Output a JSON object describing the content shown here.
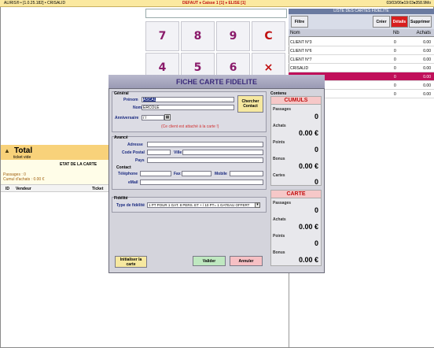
{
  "titlebar": {
    "left": "ALIRIS® • [1.0.25.182] • CRISALID",
    "center": "DEFAUT ♦ Caisse 1 [1] ♦ ELISE [1]",
    "right": "03/03/06♦19:03♦358.9Mo"
  },
  "keypad": {
    "k7": "7",
    "k8": "8",
    "k9": "9",
    "kc": "C",
    "k4": "4",
    "k5": "5",
    "k6": "6",
    "kx": "×"
  },
  "list": {
    "title": "LISTE DES CARTES FIDELITE",
    "buttons": {
      "filtre": "Filtre",
      "creer": "Créer",
      "details": "Détails",
      "supprimer": "Supprimer"
    },
    "columns": {
      "nom": "Nom",
      "nb": "Nb",
      "achats": "Achats"
    },
    "rows": [
      {
        "nom": "CLIENT N°3",
        "nb": "0",
        "achats": "0.00"
      },
      {
        "nom": "CLIENT N°6",
        "nb": "0",
        "achats": "0.00"
      },
      {
        "nom": "CLIENT N°7",
        "nb": "0",
        "achats": "0.00"
      },
      {
        "nom": "CRISALID",
        "nb": "0",
        "achats": "0.00"
      },
      {
        "nom": "",
        "nb": "0",
        "achats": "0.00"
      },
      {
        "nom": "",
        "nb": "0",
        "achats": "0.00"
      },
      {
        "nom": "",
        "nb": "0",
        "achats": "0.00"
      }
    ]
  },
  "left": {
    "total": "Total",
    "ticket_status": "ticket vide",
    "etat": "ETAT DE LA CARTE",
    "passages": "Passages : 0",
    "cumul": "Cumul d'achats : 0.00 €",
    "col_id": "ID",
    "col_vendeur": "Vendeur",
    "col_ticket": "Ticket"
  },
  "dialog": {
    "title": "FICHE CARTE FIDELITE",
    "general": {
      "section": "Général",
      "prenom_label": "Prénom",
      "prenom_value": "ASCAL",
      "nom_label": "Nom",
      "nom_value": "ERCOLE",
      "anniv_label": "Anniversaire",
      "anniv_value": "/ /",
      "chercher": "Chercher Contact",
      "notice": "(Ce client est attaché à la carte !)"
    },
    "avance": {
      "section": "Avancé",
      "adresse": "Adresse",
      "code_postal": "Code Postal",
      "ville": "Ville",
      "pays": "Pays",
      "contact": "Contact",
      "telephone": "Téléphone",
      "fax": "Fax",
      "mobile": "Mobile",
      "email": "eMail"
    },
    "fidelite": {
      "section": "Fidélité",
      "type_label": "Type de fidélité",
      "type_value": "1 PT POUR 1 GAT. 8 PERS. ET + / 10 PT= 1 GATEAU OFFERT"
    },
    "buttons": {
      "init": "Initialiser la carte",
      "valider": "Valider",
      "annuler": "Annuler"
    },
    "contenu": {
      "section": "Contenu",
      "cumuls_title": "CUMULS",
      "carte_title": "CARTE",
      "cumuls": [
        {
          "label": "Passages",
          "value": "0"
        },
        {
          "label": "Achats",
          "value": "0.00 €"
        },
        {
          "label": "Points",
          "value": "0"
        },
        {
          "label": "Bonus",
          "value": "0.00 €"
        },
        {
          "label": "Cartes",
          "value": "0"
        }
      ],
      "carte": [
        {
          "label": "Passages",
          "value": "0"
        },
        {
          "label": "Achats",
          "value": "0.00 €"
        },
        {
          "label": "Points",
          "value": "0"
        },
        {
          "label": "Bonus",
          "value": "0.00 €"
        }
      ]
    }
  }
}
